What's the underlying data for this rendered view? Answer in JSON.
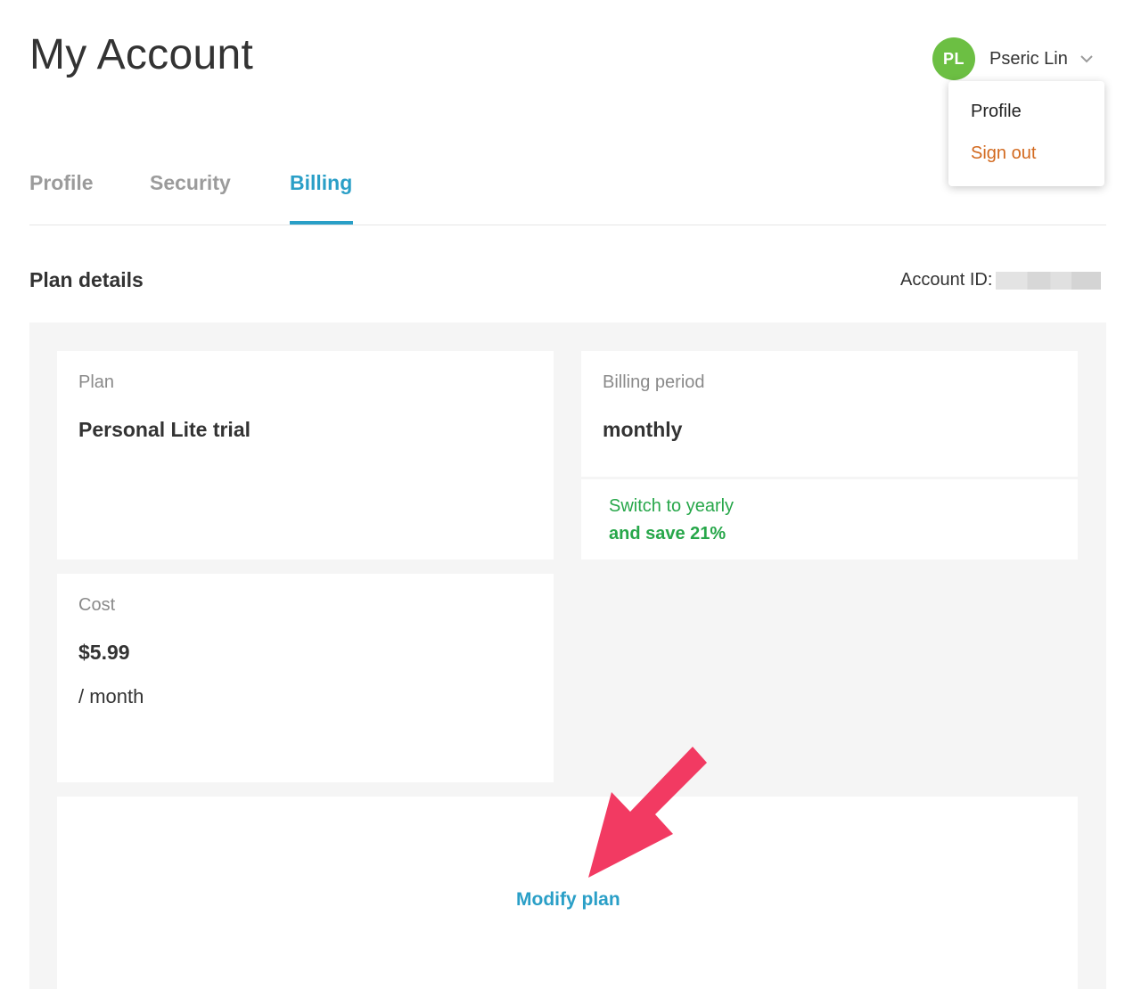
{
  "page": {
    "title": "My Account"
  },
  "user": {
    "initials": "PL",
    "name": "Pseric Lin",
    "avatar_color": "#6cbf43",
    "menu_icon": "chevron-down-icon",
    "dropdown": {
      "profile": "Profile",
      "sign_out": "Sign out"
    }
  },
  "tabs": [
    {
      "label": "Profile",
      "active": false
    },
    {
      "label": "Security",
      "active": false
    },
    {
      "label": "Billing",
      "active": true
    }
  ],
  "plan_details": {
    "title": "Plan details",
    "account_id_label": "Account ID:",
    "plan": {
      "label": "Plan",
      "value": "Personal Lite trial"
    },
    "billing_period": {
      "label": "Billing period",
      "value": "monthly"
    },
    "switch_offer": {
      "line1": "Switch to yearly",
      "line2": "and save  21%"
    },
    "cost": {
      "label": "Cost",
      "value": "$5.99",
      "unit": "/ month"
    },
    "modify_label": "Modify plan"
  },
  "colors": {
    "accent": "#2a9fc7",
    "success": "#27a74a",
    "danger": "#d2691e",
    "annotation_arrow": "#f23a62"
  }
}
